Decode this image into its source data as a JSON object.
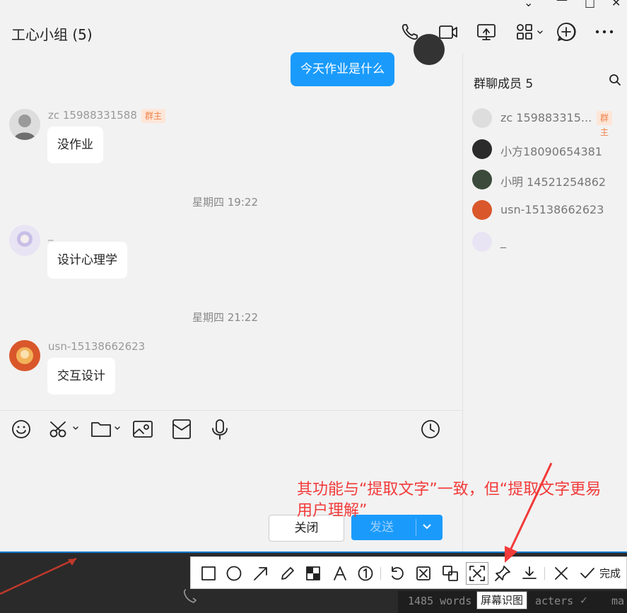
{
  "window": {
    "title": "工心小组 (5)",
    "controls": [
      "minimize-chevron",
      "minimize",
      "maximize",
      "close"
    ]
  },
  "header_icons": [
    "phone-icon",
    "video-icon",
    "screen-share-icon",
    "apps-icon",
    "add-circle-icon",
    "more-icon"
  ],
  "messages": {
    "outgoing": {
      "text": "今天作业是什么"
    },
    "msg1": {
      "sender": "zc 15988331588",
      "badge": "群主",
      "text": "没作业"
    },
    "time1": "星期四 19:22",
    "msg2": {
      "sender": "_",
      "text": "设计心理学"
    },
    "time2": "星期四 21:22",
    "msg3": {
      "sender": "usn-15138662623",
      "text": "交互设计"
    }
  },
  "members": {
    "title": "群聊成员 5",
    "list": [
      {
        "name": "zc 159883315...",
        "badge": "群主"
      },
      {
        "name": "小方18090654381"
      },
      {
        "name": "小明 14521254862"
      },
      {
        "name": "usn-15138662623"
      },
      {
        "name": "_"
      }
    ]
  },
  "input_toolbar": [
    "emoji-icon",
    "scissors-icon",
    "folder-icon",
    "image-icon",
    "red-packet-icon",
    "microphone-icon",
    "history-icon"
  ],
  "buttons": {
    "close": "关闭",
    "send": "发送"
  },
  "annotation": "其功能与“提取文字”一致，但“提取文字更易用户理解”",
  "screenshot_toolbar": {
    "tools": [
      "rectangle-icon",
      "ellipse-icon",
      "arrow-icon",
      "pencil-icon",
      "mosaic-icon",
      "text-icon",
      "number-icon",
      "undo-icon",
      "cut-icon",
      "translate-icon",
      "recognize-icon",
      "pin-icon",
      "download-icon",
      "cancel-icon",
      "done-icon"
    ],
    "done_label": "完成",
    "tooltip": "屏幕识图"
  },
  "editor_status": {
    "words": "1485 words",
    "characters": "acters",
    "tail": "ma"
  },
  "colors": {
    "accent": "#1a9bfc",
    "annotation": "#f23a3a",
    "badge_bg": "#fde6d8",
    "badge_text": "#f0834a"
  }
}
